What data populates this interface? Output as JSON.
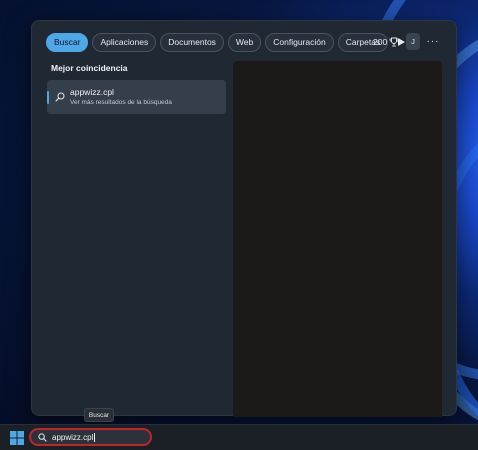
{
  "search_panel": {
    "tabs": [
      {
        "label": "Buscar",
        "active": true
      },
      {
        "label": "Aplicaciones",
        "active": false
      },
      {
        "label": "Documentos",
        "active": false
      },
      {
        "label": "Web",
        "active": false
      },
      {
        "label": "Configuración",
        "active": false
      },
      {
        "label": "Carpetas",
        "active": false
      }
    ],
    "more_tabs_icon": "play-arrow-icon",
    "points": "200",
    "points_icon": "trophy-icon",
    "user_initial": "J",
    "more_options": "···",
    "best_match_heading": "Mejor coincidencia",
    "best_match": {
      "title": "appwizz.cpl",
      "subtitle": "Ver más resultados de la búsqueda",
      "icon": "search-icon"
    }
  },
  "tooltip": "Buscar",
  "taskbar": {
    "start_icon": "windows-start-icon",
    "search_value": "appwizz.cpl",
    "search_icon": "search-icon"
  },
  "colors": {
    "accent": "#4ea8e8",
    "highlight_border": "#c0242c"
  }
}
